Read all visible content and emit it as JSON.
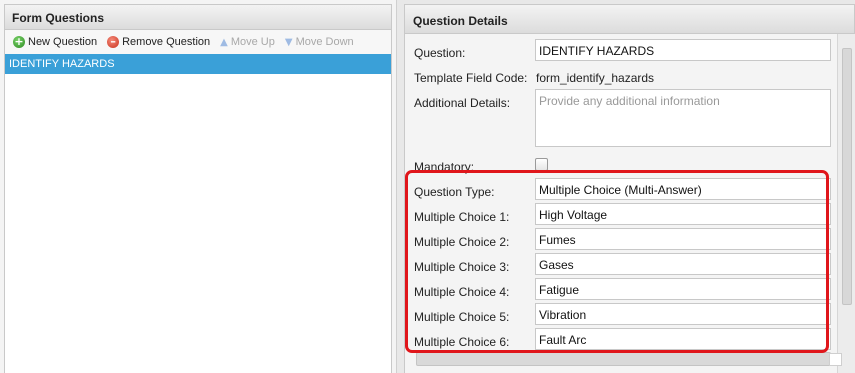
{
  "left": {
    "title": "Form Questions",
    "toolbar": {
      "new_label": "New Question",
      "remove_label": "Remove Question",
      "move_up_label": "Move Up",
      "move_down_label": "Move Down",
      "new_icon": "+",
      "remove_icon": "–",
      "up_icon": "▲",
      "down_icon": "▼"
    },
    "items": [
      {
        "label": "IDENTIFY HAZARDS"
      }
    ]
  },
  "right": {
    "title": "Question Details",
    "question_label": "Question:",
    "question_value": "IDENTIFY HAZARDS",
    "template_code_label": "Template Field Code:",
    "template_code_value": "form_identify_hazards",
    "additional_label": "Additional Details:",
    "additional_placeholder": "Provide any additional information",
    "mandatory_label": "Mandatory:",
    "question_type_label": "Question Type:",
    "question_type_value": "Multiple Choice (Multi-Answer)",
    "choices": [
      {
        "label": "Multiple Choice 1:",
        "value": "High Voltage"
      },
      {
        "label": "Multiple Choice 2:",
        "value": "Fumes"
      },
      {
        "label": "Multiple Choice 3:",
        "value": "Gases"
      },
      {
        "label": "Multiple Choice 4:",
        "value": "Fatigue"
      },
      {
        "label": "Multiple Choice 5:",
        "value": "Vibration"
      },
      {
        "label": "Multiple Choice 6:",
        "value": "Fault Arc"
      }
    ]
  },
  "colors": {
    "selection": "#3aa0d8",
    "highlight_border": "#e0161b"
  }
}
